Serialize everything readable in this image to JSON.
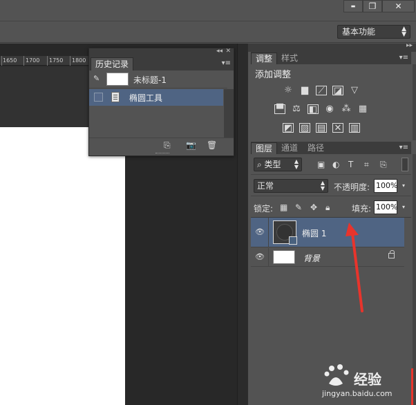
{
  "workspace": {
    "label": "基本功能"
  },
  "window_controls": {
    "minimize": "▬",
    "restore": "❐",
    "close": "✕"
  },
  "ruler": {
    "ticks": [
      "1650",
      "1700",
      "1750",
      "1800"
    ]
  },
  "history_panel": {
    "tab": "历史记录",
    "snapshot_name": "未标题-1",
    "states": [
      "椭圆工具"
    ]
  },
  "adjustments_panel": {
    "tabs": [
      "调整",
      "样式"
    ],
    "heading": "添加调整",
    "icons": [
      [
        "brightness-icon",
        "levels-icon",
        "curves-icon",
        "exposure-icon",
        "vibrance-icon"
      ],
      [
        "hue-saturation-icon",
        "color-balance-icon",
        "black-white-icon",
        "photo-filter-icon",
        "channel-mixer-icon",
        "color-lookup-icon"
      ],
      [
        "invert-icon",
        "posterize-icon",
        "threshold-icon",
        "selective-color-icon",
        "gradient-map-icon"
      ]
    ]
  },
  "layers_panel": {
    "tabs": [
      "图层",
      "通道",
      "路径"
    ],
    "filter_kind": "类型",
    "blend_mode": "正常",
    "opacity_label": "不透明度:",
    "opacity_value": "100%",
    "lock_label": "锁定:",
    "fill_label": "填充:",
    "fill_value": "100%",
    "layers": [
      {
        "name": "椭圆 1",
        "type": "shape",
        "active": true
      },
      {
        "name": "背景",
        "type": "background",
        "active": false,
        "locked": true
      }
    ]
  },
  "watermark": {
    "brand": "经验",
    "url": "jingyan.baidu.com"
  },
  "colors": {
    "selection": "#4f6483",
    "annotation_arrow": "#e8342c"
  }
}
